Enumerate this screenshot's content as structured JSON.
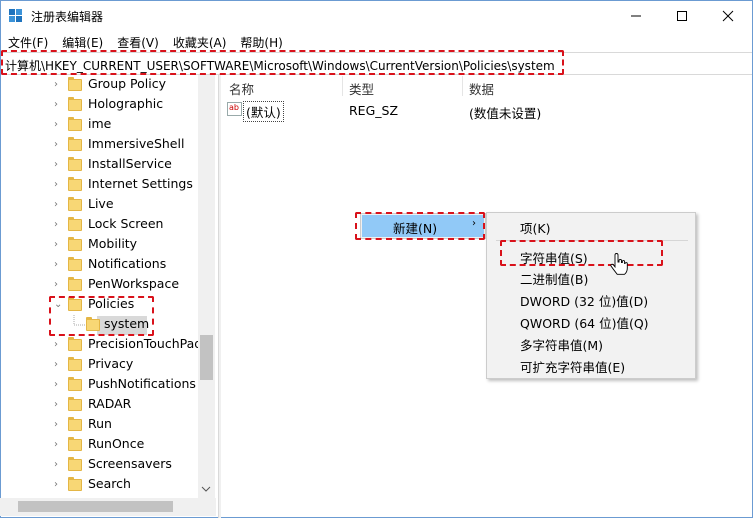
{
  "window": {
    "title": "注册表编辑器"
  },
  "menubar": {
    "items": [
      "文件(F)",
      "编辑(E)",
      "查看(V)",
      "收藏夹(A)",
      "帮助(H)"
    ]
  },
  "address": {
    "path": "计算机\\HKEY_CURRENT_USER\\SOFTWARE\\Microsoft\\Windows\\CurrentVersion\\Policies\\system"
  },
  "tree": {
    "items": [
      "Group Policy",
      "Holographic",
      "ime",
      "ImmersiveShell",
      "InstallService",
      "Internet Settings",
      "Live",
      "Lock Screen",
      "Mobility",
      "Notifications",
      "PenWorkspace",
      "Policies",
      "system",
      "PrecisionTouchPad",
      "Privacy",
      "PushNotifications",
      "RADAR",
      "Run",
      "RunOnce",
      "Screensavers",
      "Search"
    ],
    "selected": "system"
  },
  "list": {
    "columns": [
      "名称",
      "类型",
      "数据"
    ],
    "rows": [
      {
        "name": "(默认)",
        "type": "REG_SZ",
        "data": "(数值未设置)"
      }
    ]
  },
  "context_menu": {
    "item": "新建(N)",
    "submenu": [
      "项(K)",
      "字符串值(S)",
      "二进制值(B)",
      "DWORD (32 位)值(D)",
      "QWORD (64 位)值(Q)",
      "多字符串值(M)",
      "可扩充字符串值(E)"
    ]
  },
  "icons": {
    "app": "regedit-icon",
    "minimize": "minimize-icon",
    "maximize": "maximize-icon",
    "close": "close-icon",
    "folder": "folder-icon",
    "string_value": "string-value-icon",
    "pointer": "hand-cursor-icon"
  },
  "colors": {
    "highlight_dash": "#d9121b",
    "menu_hover": "#91c9f7",
    "folder": "#f8d775"
  }
}
